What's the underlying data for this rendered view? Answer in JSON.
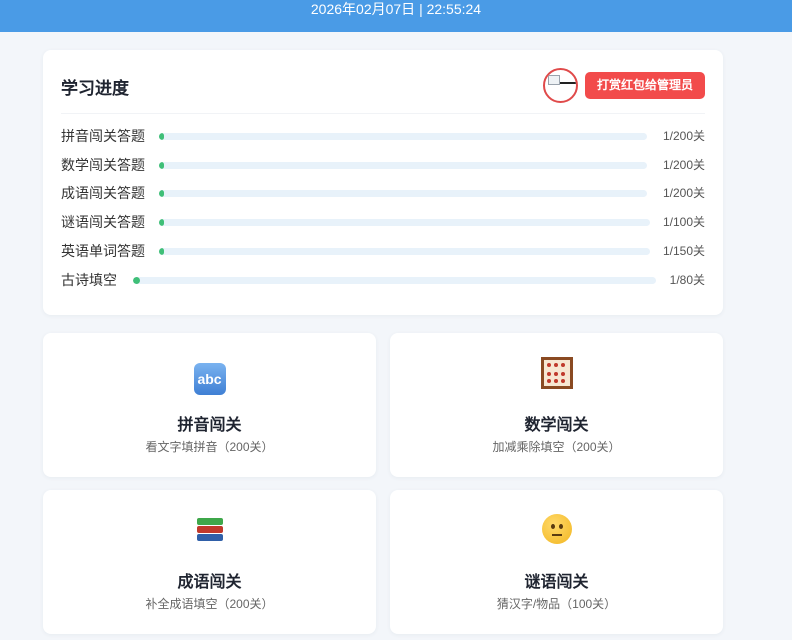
{
  "header": {
    "datetime": "2026年02月07日 | 22:55:24",
    "color": "#4a9be6"
  },
  "progress": {
    "title": "学习进度",
    "reward_button": "打赏红包给管理员",
    "rows": [
      {
        "label": "拼音闯关答题",
        "value": "1/200关",
        "fraction": 0.005
      },
      {
        "label": "数学闯关答题",
        "value": "1/200关",
        "fraction": 0.005
      },
      {
        "label": "成语闯关答题",
        "value": "1/200关",
        "fraction": 0.005
      },
      {
        "label": "谜语闯关答题",
        "value": "1/100关",
        "fraction": 0.01
      },
      {
        "label": "英语单词答题",
        "value": "1/150关",
        "fraction": 0.0067
      },
      {
        "label": "古诗填空",
        "value": "1/80关",
        "fraction": 0.0125
      }
    ]
  },
  "games": [
    {
      "icon": "abc-icon",
      "title": "拼音闯关",
      "desc": "看文字填拼音（200关）"
    },
    {
      "icon": "abacus-icon",
      "title": "数学闯关",
      "desc": "加减乘除填空（200关）"
    },
    {
      "icon": "books-icon",
      "title": "成语闯关",
      "desc": "补全成语填空（200关）"
    },
    {
      "icon": "thinking-face-icon",
      "title": "谜语闯关",
      "desc": "猜汉字/物品（100关）"
    }
  ],
  "colors": {
    "progress_fill": "#3fbf78",
    "track": "#e8f2fa",
    "reward": "#f24b4b"
  }
}
